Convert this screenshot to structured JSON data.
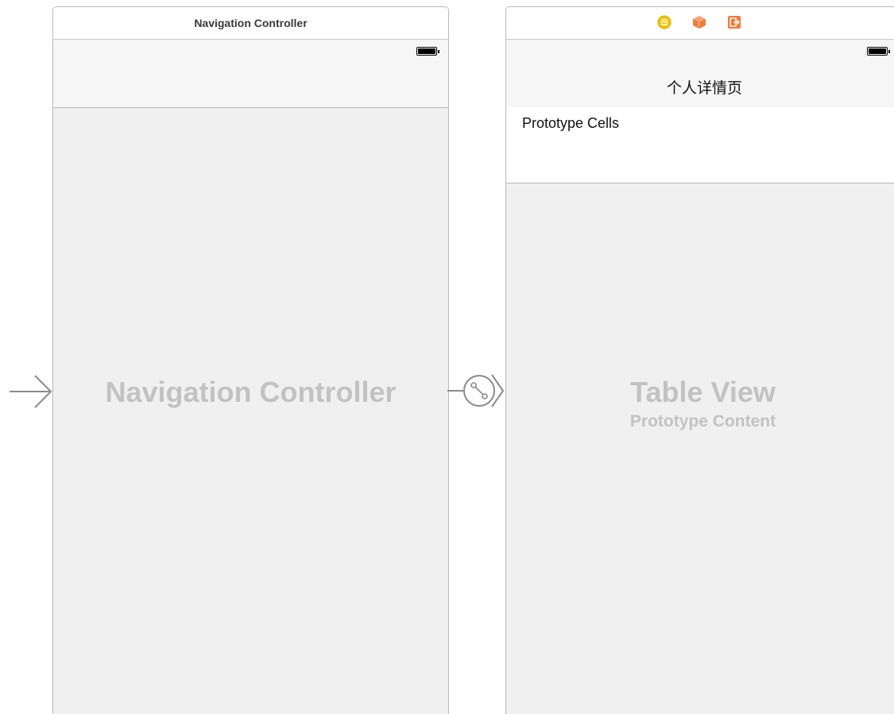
{
  "left_scene": {
    "header_title": "Navigation Controller",
    "watermark": "Navigation Controller"
  },
  "right_scene": {
    "dock_icons": [
      "view-controller-icon",
      "first-responder-icon",
      "exit-icon"
    ],
    "nav_title": "个人详情页",
    "prototype_cells_label": "Prototype Cells",
    "watermark_title": "Table View",
    "watermark_subtitle": "Prototype Content"
  },
  "colors": {
    "canvas": "#ffffff",
    "scene_bg": "#f0f0f0",
    "watermark": "#c2c2c2",
    "icon_yellow": "#f5c400",
    "icon_orange": "#f07b3a"
  }
}
